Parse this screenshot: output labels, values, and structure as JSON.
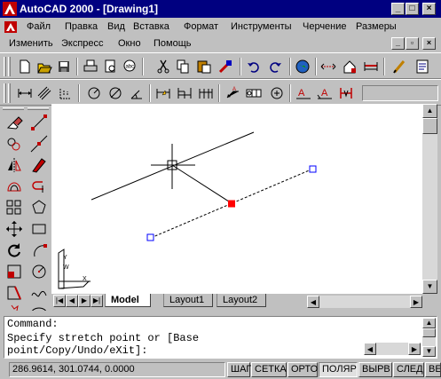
{
  "window": {
    "title": "AutoCAD 2000 - [Drawing1]"
  },
  "menu_row1": [
    "Файл",
    "Правка",
    "Вид",
    "Вставка",
    "Формат",
    "Инструменты",
    "Черчение",
    "Размеры"
  ],
  "menu_row2": [
    "Изменить",
    "Экспресс",
    "Окно",
    "Помощь"
  ],
  "standard_toolbar": {
    "buttons": [
      "new-icon",
      "open-icon",
      "save-icon",
      "print-icon",
      "print-preview-icon",
      "spell-check-icon",
      "cut-icon",
      "copy-icon",
      "paste-icon",
      "match-properties-icon",
      "undo-icon",
      "redo-icon",
      "internet-icon",
      "distance-icon",
      "insert-block-icon",
      "measure-icon",
      "draw-icon",
      "properties-icon"
    ]
  },
  "dimension_toolbar": {
    "buttons": [
      "linear-dim-icon",
      "aligned-dim-icon",
      "ordinate-dim-icon",
      "radius-dim-icon",
      "diameter-dim-icon",
      "angular-dim-icon",
      "quick-dim-icon",
      "baseline-dim-icon",
      "continue-dim-icon",
      "leader-icon",
      "tolerance-icon",
      "center-mark-icon",
      "dim-edit-icon",
      "dim-text-edit-icon",
      "dim-update-icon"
    ],
    "style_field_value": ""
  },
  "modify_toolbar": [
    "erase-icon",
    "copy-object-icon",
    "mirror-icon",
    "offset-icon",
    "array-icon",
    "move-icon",
    "rotate-icon",
    "scale-icon",
    "stretch-icon",
    "explode-icon"
  ],
  "draw_toolbar": [
    "line-icon",
    "construction-line-icon",
    "polyline-icon",
    "polygon-icon",
    "rectangle-icon",
    "arc-icon",
    "circle-icon",
    "spline-icon",
    "ellipse-icon"
  ],
  "layout_tabs": [
    "Model",
    "Layout1",
    "Layout2"
  ],
  "ucs": {
    "x_label": "X",
    "y_label": "Y",
    "w_label": "W"
  },
  "command": {
    "line1": "Command:",
    "line2": "Specify stretch point or [Base",
    "line3": "point/Copy/Undo/eXit]:"
  },
  "status": {
    "coords": "286.9614, 301.0744, 0.0000",
    "snap": "ШАГ",
    "grid": "СЕТКА",
    "ortho": "ОРТО",
    "polar": "ПОЛЯР",
    "osnap": "ВЫРВ",
    "otrack": "СЛЕД",
    "lwt": "ВЕ"
  },
  "colors": {
    "title_bg": "#000080",
    "face": "#c0c0c0",
    "grip_hot": "#ff0000",
    "grip_cold": "#0000ff"
  }
}
